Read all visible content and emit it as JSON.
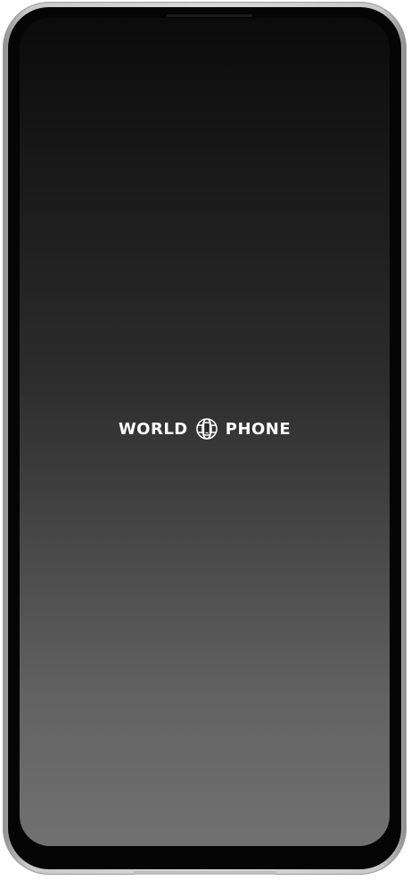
{
  "device": {
    "frame_color": "#c9c9c9",
    "bezel_color": "#050505"
  },
  "screen": {
    "background_top": "#0b0b0b",
    "background_bottom": "#717171",
    "logo": {
      "left_text": "WORLD",
      "right_text": "PHONE",
      "icon": "globe-phone-icon",
      "color": "#ffffff"
    }
  }
}
